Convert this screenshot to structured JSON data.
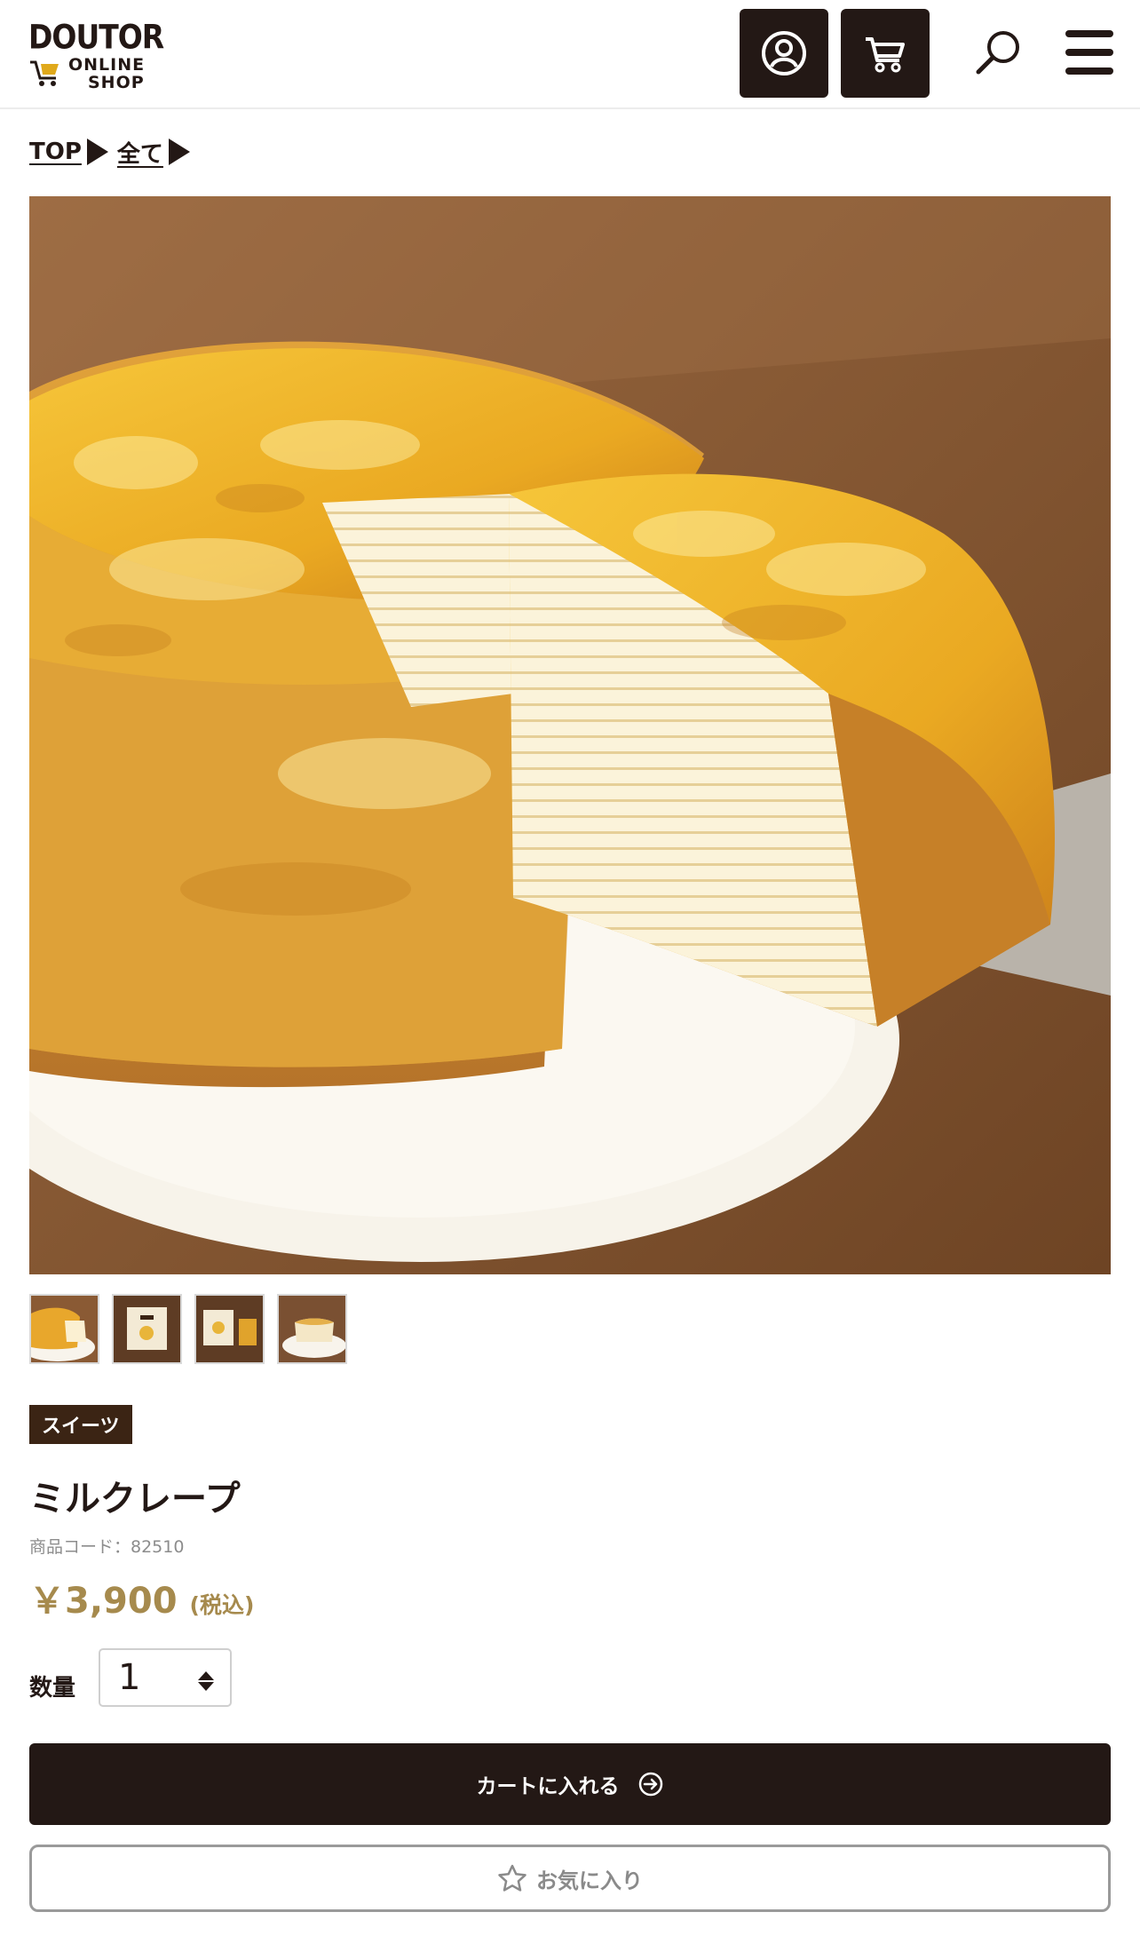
{
  "header": {
    "logo_word": "DOUTOR",
    "logo_line1": "ONLINE",
    "logo_line2": "SHOP",
    "account_icon": "account-circle-icon",
    "cart_icon": "cart-icon",
    "search_icon": "search-icon",
    "menu_icon": "hamburger-menu-icon"
  },
  "breadcrumb": {
    "items": [
      {
        "label": "TOP"
      },
      {
        "label": "全て"
      }
    ]
  },
  "gallery": {
    "thumbnail_count": 4
  },
  "product": {
    "category": "スイーツ",
    "name": "ミルクレープ",
    "code_label": "商品コード：82510",
    "price": "￥3,900",
    "tax_note": "(税込)"
  },
  "quantity": {
    "label": "数量",
    "value": "1"
  },
  "actions": {
    "add_to_cart": "カートに入れる",
    "favorite": "お気に入り"
  },
  "colors": {
    "brand_dark": "#231815",
    "price_gold": "#a68a4d",
    "badge_brown": "#3b2414"
  }
}
